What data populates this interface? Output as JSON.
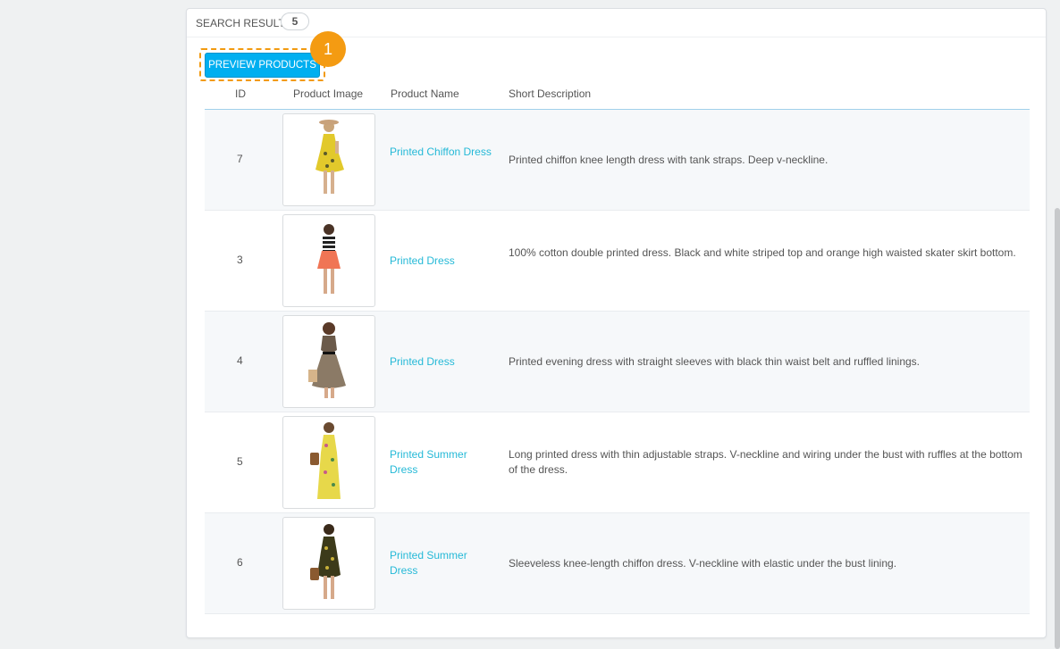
{
  "panel": {
    "title": "SEARCH RESULTS",
    "count": "5"
  },
  "actions": {
    "preview_label": "PREVIEW PRODUCTS",
    "step_marker": "1"
  },
  "table": {
    "headers": [
      "ID",
      "Product Image",
      "Product Name",
      "Short Description"
    ],
    "rows": [
      {
        "id": "7",
        "name": "Printed Chiffon Dress",
        "desc": "Printed chiffon knee length dress with tank straps. Deep v-neckline."
      },
      {
        "id": "3",
        "name": "Printed Dress",
        "desc": "100% cotton double printed dress. Black and white striped top and orange high waisted skater skirt bottom."
      },
      {
        "id": "4",
        "name": "Printed Dress",
        "desc": "Printed evening dress with straight sleeves with black thin waist belt and ruffled linings."
      },
      {
        "id": "5",
        "name": "Printed Summer Dress",
        "desc": "Long printed dress with thin adjustable straps. V-neckline and wiring under the bust with ruffles at the bottom of the dress."
      },
      {
        "id": "6",
        "name": "Printed Summer Dress",
        "desc": "Sleeveless knee-length chiffon dress. V-neckline with elastic under the bust lining."
      }
    ]
  },
  "colors": {
    "accent": "#00aff0",
    "link": "#25b9d7",
    "marker": "#f49b12"
  }
}
